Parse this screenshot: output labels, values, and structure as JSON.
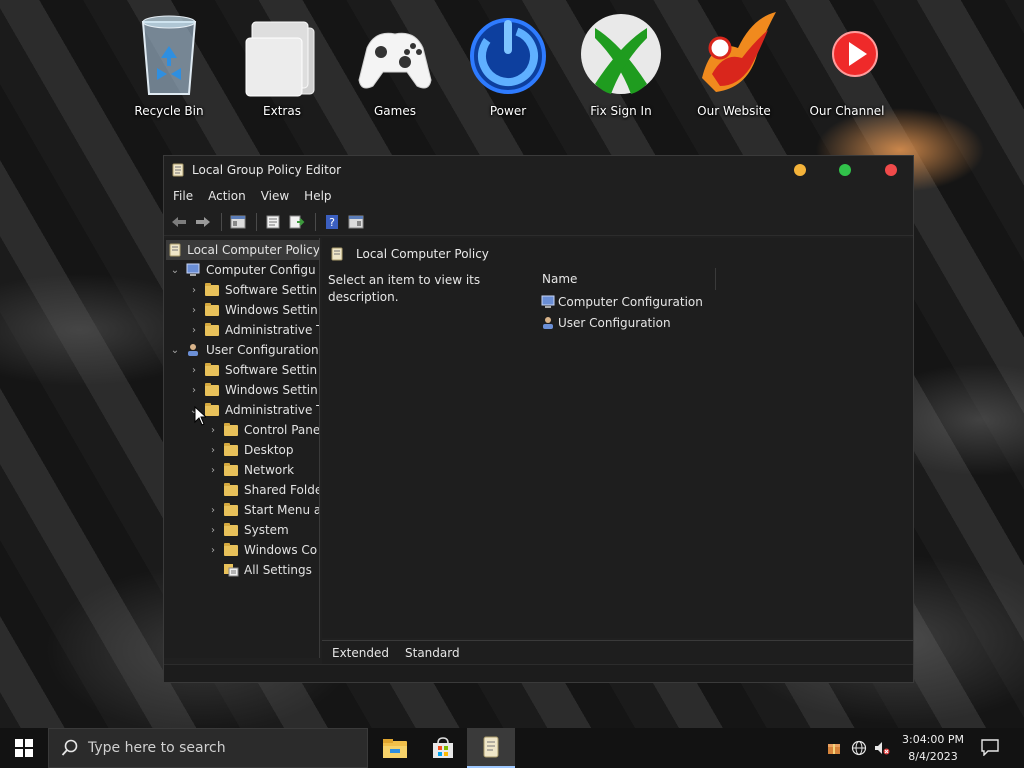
{
  "desktop": {
    "icons": [
      {
        "label": "Recycle Bin",
        "icon": "recycle-bin-icon"
      },
      {
        "label": "Extras",
        "icon": "folder-icon"
      },
      {
        "label": "Games",
        "icon": "gamepad-icon"
      },
      {
        "label": "Power",
        "icon": "power-icon"
      },
      {
        "label": "Fix Sign In",
        "icon": "xbox-icon"
      },
      {
        "label": "Our Website",
        "icon": "phoenix-icon"
      },
      {
        "label": "Our Channel",
        "icon": "play-icon"
      }
    ]
  },
  "window": {
    "title": "Local Group Policy Editor",
    "menu": [
      "File",
      "Action",
      "View",
      "Help"
    ],
    "tree": {
      "root": "Local Computer Policy",
      "computer_config": "Computer Configu",
      "cc_children": [
        "Software Settin",
        "Windows Settin",
        "Administrative T"
      ],
      "user_config": "User Configuration",
      "uc_children": [
        "Software Settin",
        "Windows Settin",
        "Administrative T"
      ],
      "admin_children": [
        "Control Pane",
        "Desktop",
        "Network",
        "Shared Folde",
        "Start Menu a",
        "System",
        "Windows Co"
      ],
      "all_settings": "All Settings"
    },
    "content": {
      "header": "Local Computer Policy",
      "description": "Select an item to view its description.",
      "column_name": "Name",
      "items": [
        "Computer Configuration",
        "User Configuration"
      ]
    },
    "tabs": [
      "Extended",
      "Standard"
    ]
  },
  "taskbar": {
    "search_placeholder": "Type here to search",
    "time": "3:04:00 PM",
    "date": "8/4/2023"
  },
  "colors": {
    "accent_selected": "#3a3a3a",
    "folder": "#e8c15a",
    "close": "#f04a4a",
    "minimize": "#f4b33a",
    "maximize": "#31c24a"
  }
}
